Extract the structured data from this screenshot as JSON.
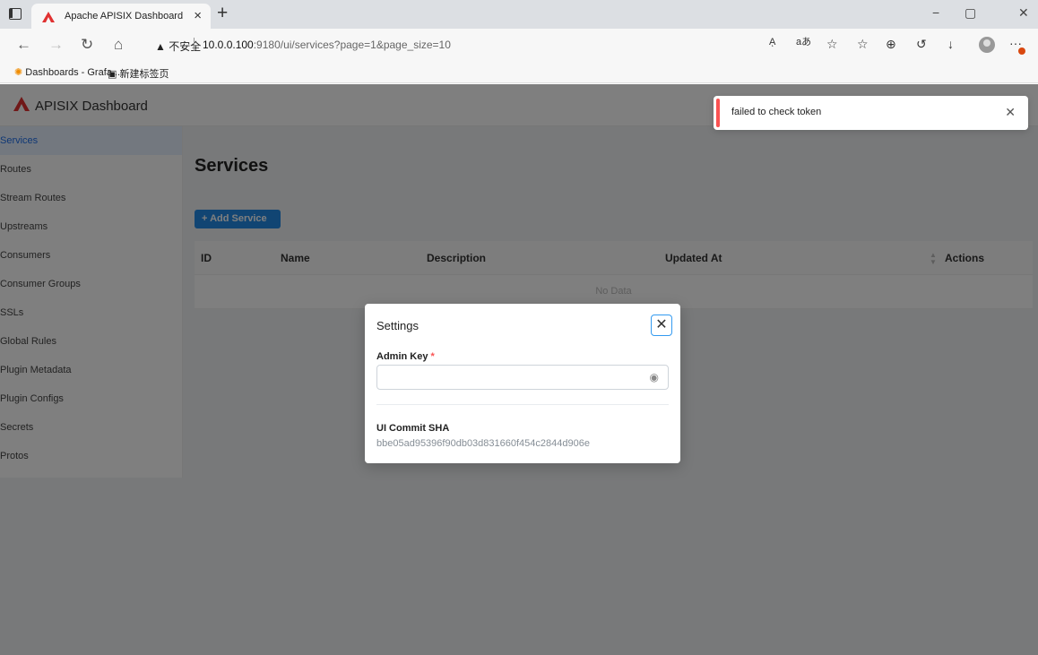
{
  "browser": {
    "tab_title": "Apache APISIX Dashboard",
    "tab_close": "×",
    "new_tab": "+",
    "window_controls": {
      "minimize": "−",
      "maximize": "▢",
      "close": "✕"
    },
    "nav": {
      "back": "←",
      "forward": "→",
      "reload": "↻",
      "home": "⌂"
    },
    "security_warning": "▲ 不安全",
    "url_host": "10.0.0.100",
    "url_path": ":9180/ui/services?page=1&page_size=10",
    "toolbar_icons": [
      "read-aloud-icon",
      "translate-icon",
      "favorite-add-icon",
      "favorites-icon",
      "collections-icon",
      "history-icon",
      "downloads-icon"
    ],
    "toolbar_glyphs": {
      "read_aloud": "Aͅ",
      "translate": "aあ",
      "favorite_add": "☆",
      "favorites": "☆",
      "collections": "⊕",
      "history": "↺",
      "downloads": "↓"
    },
    "menu": "···",
    "bookmarks": [
      {
        "label": "Dashboards - Grafa...",
        "icon": "grafana-icon"
      },
      {
        "label": "新建标签页",
        "icon": "new-tab-page-icon"
      }
    ]
  },
  "app": {
    "brand": "APISIX Dashboard",
    "brand_color": "#e03131",
    "accent_color": "#228be6",
    "sidebar": {
      "items": [
        {
          "label": "Services",
          "active": true
        },
        {
          "label": "Routes"
        },
        {
          "label": "Stream Routes"
        },
        {
          "label": "Upstreams"
        },
        {
          "label": "Consumers"
        },
        {
          "label": "Consumer Groups"
        },
        {
          "label": "SSLs"
        },
        {
          "label": "Global Rules"
        },
        {
          "label": "Plugin Metadata"
        },
        {
          "label": "Plugin Configs"
        },
        {
          "label": "Secrets"
        },
        {
          "label": "Protos"
        }
      ]
    },
    "main": {
      "title": "Services",
      "add_button": "+ Add Service",
      "table": {
        "columns": [
          "ID",
          "Name",
          "Description",
          "Updated At",
          "Actions"
        ],
        "empty_text": "No Data"
      }
    }
  },
  "modal": {
    "title": "Settings",
    "close": "✕",
    "admin_key_label": "Admin Key",
    "required_mark": "*",
    "admin_key_value": "",
    "commit_label": "UI Commit SHA",
    "commit_value": "bbe05ad95396f90db03d831660f454c2844d906e"
  },
  "toast": {
    "message": "failed to check token",
    "close": "✕",
    "color": "#fa5252"
  }
}
